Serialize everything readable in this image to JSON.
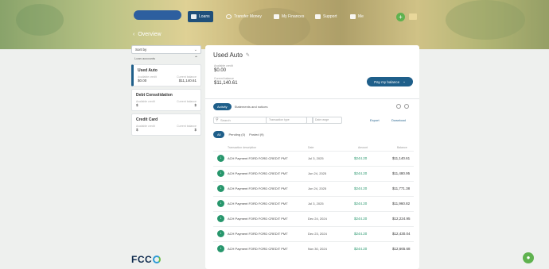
{
  "nav": {
    "org_pill": "",
    "items": [
      {
        "label": "Loans",
        "active": true
      },
      {
        "label": "Transfer Money",
        "active": false
      },
      {
        "label": "My Finances",
        "active": false
      },
      {
        "label": "Support",
        "active": false
      },
      {
        "label": "Me",
        "active": false
      }
    ],
    "user_label": ""
  },
  "breadcrumb": {
    "back_label": "Overview"
  },
  "sidebar": {
    "sort_label": "Sort by",
    "group_label": "Loan accounts",
    "cards": [
      {
        "name": "Used Auto",
        "sub": "",
        "label_left": "Available credit",
        "label_right": "Current balance",
        "value_left": "$0.00",
        "value_right": "$11,140.61",
        "active": true
      },
      {
        "name": "Debt Consolidation",
        "sub": "",
        "label_left": "Available credit",
        "label_right": "Current balance",
        "value_left": "$",
        "value_right": "$",
        "active": false
      },
      {
        "name": "Credit Card",
        "sub": "",
        "label_left": "Available credit",
        "label_right": "Current balance",
        "value_left": "$",
        "value_right": "$",
        "active": false
      }
    ]
  },
  "main": {
    "title": "Used Auto",
    "metric1_label": "Available credit",
    "metric1_value": "$0.00",
    "metric2_label": "Current balance",
    "metric2_value": "$11,140.61",
    "pay_button": "Pay my balance",
    "seg_on": "Activity",
    "seg_off": "Statements and notices",
    "search_placeholder": "Search",
    "filter1": "Transaction type",
    "filter2": "Date range",
    "action1": "Export",
    "action2": "Download",
    "tabs": [
      {
        "label": "All",
        "active": true
      },
      {
        "label": "Pending (0)",
        "active": false
      },
      {
        "label": "Posted (9)",
        "active": false
      }
    ],
    "columns": [
      "Transaction description",
      "Date",
      "Amount",
      "Balance"
    ],
    "rows": [
      {
        "desc": "ACH Payment FORD FORD CREDIT PMT",
        "date": "Jul 3, 2025",
        "amount": "$244.20",
        "balance": "$11,140.61"
      },
      {
        "desc": "ACH Payment FORD FORD CREDIT PMT",
        "date": "Jun 24, 2025",
        "amount": "$244.20",
        "balance": "$11,480.95"
      },
      {
        "desc": "ACH Payment FORD FORD CREDIT PMT",
        "date": "Jun 24, 2025",
        "amount": "$244.20",
        "balance": "$11,771.38"
      },
      {
        "desc": "ACH Payment FORD FORD CREDIT PMT",
        "date": "Jul 3, 2025",
        "amount": "$244.20",
        "balance": "$11,960.82"
      },
      {
        "desc": "ACH Payment FORD FORD CREDIT PMT",
        "date": "Dec 24, 2024",
        "amount": "$244.20",
        "balance": "$12,224.95"
      },
      {
        "desc": "ACH Payment FORD FORD CREDIT PMT",
        "date": "Dec 23, 2024",
        "amount": "$244.20",
        "balance": "$12,430.04"
      },
      {
        "desc": "ACH Payment FORD FORD CREDIT PMT",
        "date": "Nov 30, 2024",
        "amount": "$244.20",
        "balance": "$12,665.68"
      }
    ]
  },
  "logo_text": "FCC"
}
